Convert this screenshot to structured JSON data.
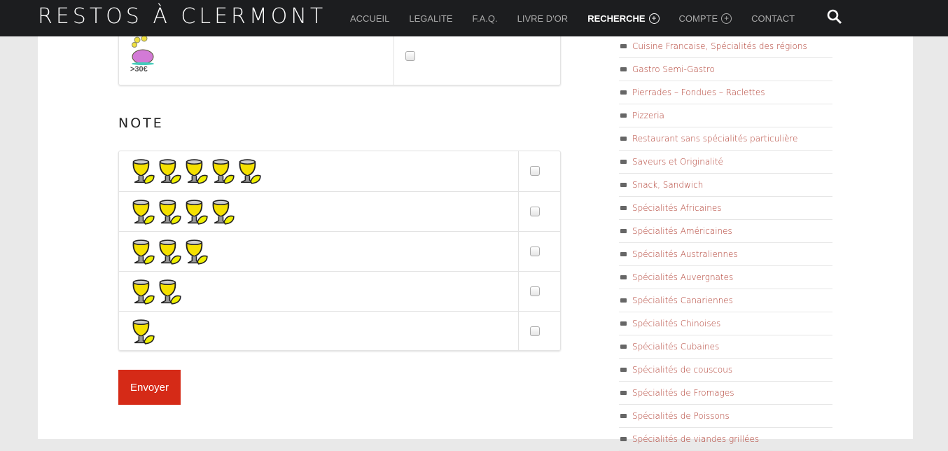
{
  "header": {
    "logo": "RESTOS À CLERMONT",
    "menu": [
      {
        "label": "ACCUEIL"
      },
      {
        "label": "LEGALITE"
      },
      {
        "label": "F.A.Q."
      },
      {
        "label": "LIVRE D'OR"
      },
      {
        "label": "RECHERCHE",
        "active": true,
        "has_submenu": true
      },
      {
        "label": "COMPTE",
        "has_submenu": true
      },
      {
        "label": "CONTACT"
      }
    ],
    "search_icon": "search-icon"
  },
  "price_table": {
    "row": {
      "icon": "piggy-bank-icon",
      "label": ">30€",
      "checked": false
    }
  },
  "note": {
    "heading": "NOTE",
    "rows": [
      {
        "rating": 5,
        "checked": false
      },
      {
        "rating": 4,
        "checked": false
      },
      {
        "rating": 3,
        "checked": false
      },
      {
        "rating": 2,
        "checked": false
      },
      {
        "rating": 1,
        "checked": false
      }
    ]
  },
  "submit_label": "Envoyer",
  "sidebar": {
    "items": [
      "Cuisine Francaise, Spécialités des régions",
      "Gastro Semi-Gastro",
      "Pierrades – Fondues – Raclettes",
      "Pizzeria",
      "Restaurant sans spécialités particulière",
      "Saveurs et Originalité",
      "Snack, Sandwich",
      "Spécialités Africaines",
      "Spécialités Américaines",
      "Spécialités Australiennes",
      "Spécialités Auvergnates",
      "Spécialités Canariennes",
      "Spécialités Chinoises",
      "Spécialités Cubaines",
      "Spécialités de couscous",
      "Spécialités de Fromages",
      "Spécialités de Poissons",
      "Spécialités de viandes grillées"
    ]
  },
  "colors": {
    "nav_bg": "#1c1d1f",
    "accent": "#d52a17",
    "link": "#b03a2e"
  }
}
